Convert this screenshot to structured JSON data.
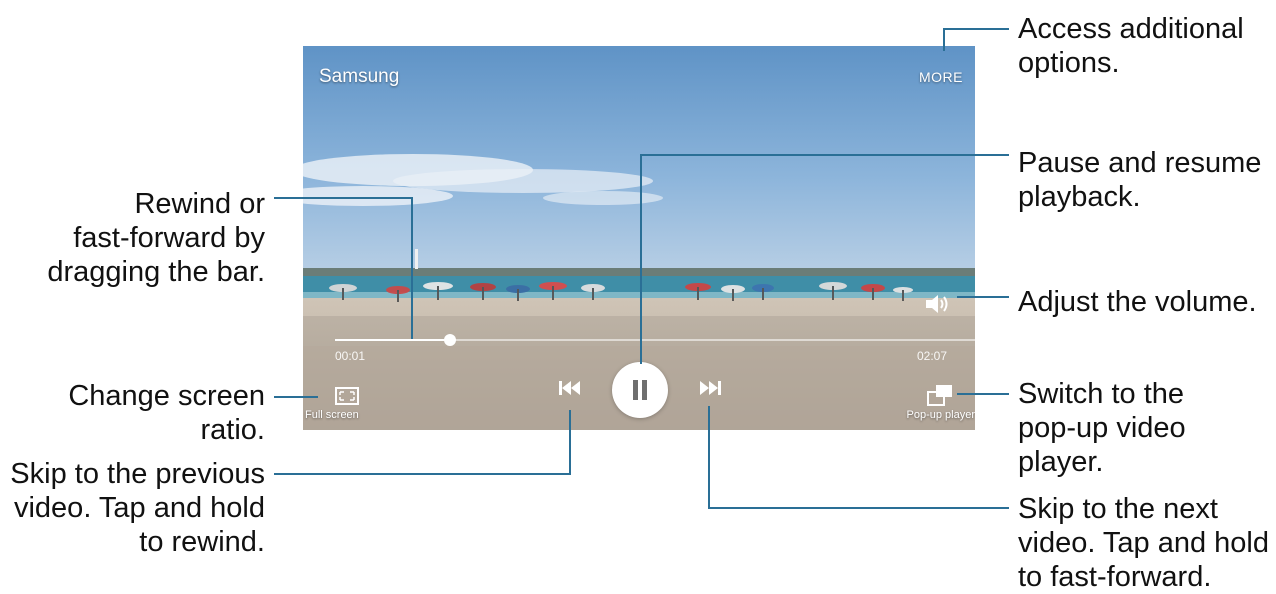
{
  "screen": {
    "title": "Samsung",
    "more_label": "MORE",
    "elapsed_time": "00:01",
    "total_time": "02:07",
    "progress_fraction": 0.18,
    "full_screen_label": "Full screen",
    "popup_label": "Pop-up player"
  },
  "callouts": {
    "more_options": "Access additional\noptions.",
    "pause_resume": "Pause and resume\nplayback.",
    "adjust_volume": "Adjust the volume.",
    "popup_player": "Switch to the\npop-up video player.",
    "next_video": "Skip to the next\nvideo. Tap and hold\nto fast-forward.",
    "rewind_bar": "Rewind or\nfast-forward by\ndragging the bar.",
    "screen_ratio": "Change screen ratio.",
    "previous_video": "Skip to the previous\nvideo. Tap and hold\nto rewind."
  },
  "icons": {
    "pause": "pause-icon",
    "previous": "skip-previous-icon",
    "next": "skip-next-icon",
    "volume": "volume-icon",
    "full_screen": "full-screen-icon",
    "popup": "popup-player-icon"
  },
  "colors": {
    "leader_line": "#2a6f96",
    "sky_top": "#5f93c6",
    "sand": "#c8bcaf"
  }
}
